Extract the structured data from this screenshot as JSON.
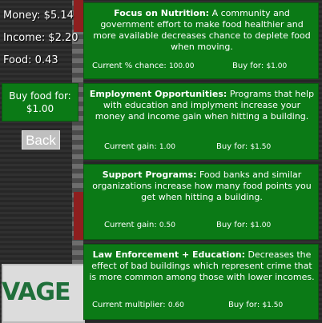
{
  "stats": {
    "money": "Money: $5.14",
    "income": "Income: $2.20",
    "food": "Food: 0.43"
  },
  "sidebar": {
    "buy_food_label": "Buy food for:",
    "buy_food_price": "$1.00",
    "back_label": "Back"
  },
  "background": {
    "sign_text": "VAGE"
  },
  "cards": [
    {
      "title": "Focus on Nutrition:",
      "description": "A community and government effort to make food healthier and more available decreases chance to deplete food when moving.",
      "stat_label": "Current % chance:",
      "stat_value": "100.00",
      "buy_label": "Buy for:",
      "price": "$1.00"
    },
    {
      "title": "Employment Opportunities:",
      "description": "Programs that help with education and implyment increase your money and income gain when hitting a building.",
      "stat_label": "Current gain:",
      "stat_value": "1.00",
      "buy_label": "Buy for:",
      "price": "$1.50"
    },
    {
      "title": "Support Programs:",
      "description": "Food banks and similar organizations increase how many food points you get when hitting a building.",
      "stat_label": "Current gain:",
      "stat_value": "0.50",
      "buy_label": "Buy for:",
      "price": "$1.00"
    },
    {
      "title": "Law Enforcement + Education:",
      "description": "Decreases the effect of bad buildings which represent crime that is more common among those with lower incomes.",
      "stat_label": "Current multiplier:",
      "stat_value": "0.60",
      "buy_label": "Buy for:",
      "price": "$1.50"
    }
  ],
  "colors": {
    "card_green": "#0b7a16",
    "back_gray": "#bfbfbf"
  }
}
